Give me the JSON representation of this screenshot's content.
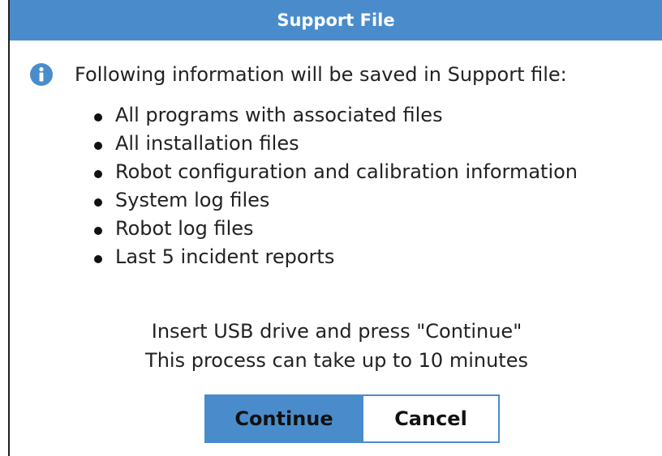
{
  "dialog": {
    "title": "Support File",
    "info_icon": "info-icon",
    "info_text": "Following information will be saved in Support file:",
    "items": [
      "All programs with associated files",
      "All installation files",
      "Robot configuration and calibration information",
      "System log files",
      "Robot log files",
      "Last 5 incident reports"
    ],
    "notice_line1": "Insert USB drive and press \"Continue\"",
    "notice_line2": "This process can take up to 10 minutes",
    "continue_label": "Continue",
    "cancel_label": "Cancel"
  },
  "colors": {
    "accent": "#4a8ccb",
    "title_text": "#ffffff"
  }
}
